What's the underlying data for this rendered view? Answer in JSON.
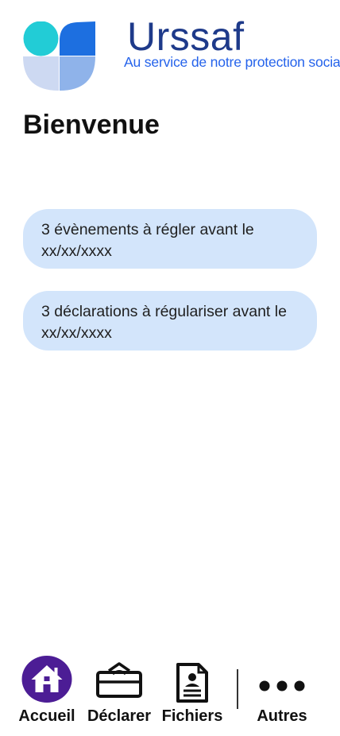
{
  "brand": {
    "name": "Urssaf",
    "tagline": "Au service de notre protection sociale",
    "logo_icon": "urssaf-logo-mark",
    "colors": {
      "navy": "#1e3a8a",
      "blue": "#2563eb",
      "teal": "#22ccd6",
      "light_blue": "#8fb3ea",
      "pale_blue": "#cdd9f2"
    }
  },
  "page": {
    "title": "Bienvenue"
  },
  "alerts": [
    {
      "text": "3 évènements à régler avant le xx/xx/xxxx"
    },
    {
      "text": "3 déclarations à régulariser avant le xx/xx/xxxx"
    }
  ],
  "alert_color": "#d3e5fb",
  "bottom_nav": {
    "active_color": "#4c1d95",
    "items": [
      {
        "label": "Accueil",
        "icon": "home-icon",
        "active": true
      },
      {
        "label": "Déclarer",
        "icon": "declare-envelope-icon",
        "active": false
      },
      {
        "label": "Fichiers",
        "icon": "document-icon",
        "active": false
      },
      {
        "label": "Autres",
        "icon": "more-dots-icon",
        "active": false
      }
    ]
  }
}
